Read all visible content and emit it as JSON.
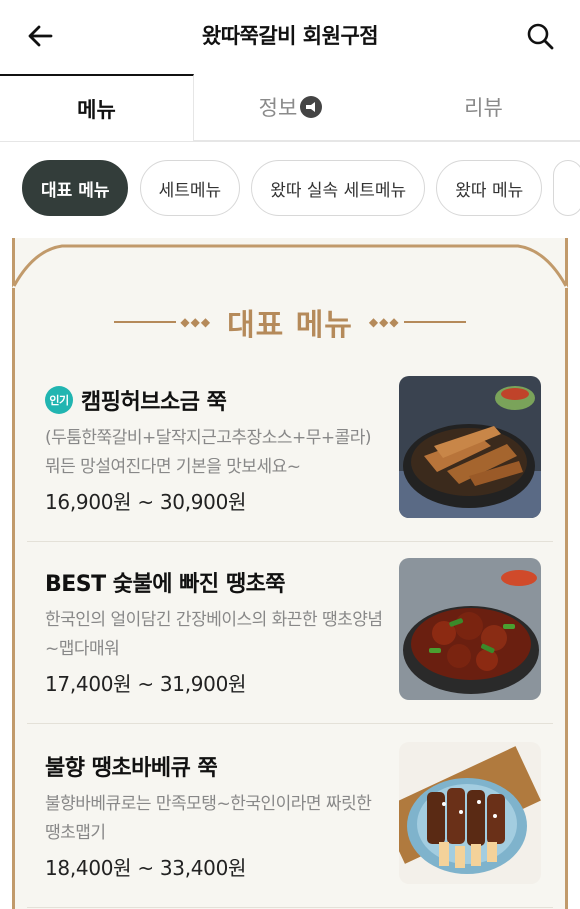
{
  "header": {
    "title": "왔따쭉갈비 회원구점"
  },
  "tabs": [
    {
      "label": "메뉴",
      "active": true
    },
    {
      "label": "정보",
      "active": false
    },
    {
      "label": "리뷰",
      "active": false
    }
  ],
  "chips": [
    {
      "label": "대표 메뉴",
      "active": true
    },
    {
      "label": "세트메뉴",
      "active": false
    },
    {
      "label": "왔따 실속 세트메뉴",
      "active": false
    },
    {
      "label": "왔따 메뉴",
      "active": false
    }
  ],
  "section": {
    "title": "대표 메뉴"
  },
  "items": [
    {
      "badge": "인기",
      "name": "캠핑허브소금 쭉",
      "description": "(두툼한쭉갈비+달작지근고추장소스+무+콜라)뭐든 망설여진다면 기본을 맛보세요~",
      "price": "16,900원 ~ 30,900원",
      "image_icon": "grilled-ribs-photo"
    },
    {
      "badge": "",
      "name": "BEST 숯불에 빠진 땡초쭉",
      "description": "한국인의 얼이담긴 간장베이스의 화끈한 땡초양념~맵다매워",
      "price": "17,400원 ~ 31,900원",
      "image_icon": "spicy-ribs-photo"
    },
    {
      "badge": "",
      "name": "불향 땡초바베큐 쭉",
      "description": "불향바베큐로는 만족모탱~한국인이라면 짜릿한 땡초맵기",
      "price": "18,400원 ~ 33,400원",
      "image_icon": "bbq-ribs-photo"
    }
  ],
  "colors": {
    "accent": "#b58a5a",
    "chip_active": "#333d3a",
    "badge": "#21b5b1"
  }
}
